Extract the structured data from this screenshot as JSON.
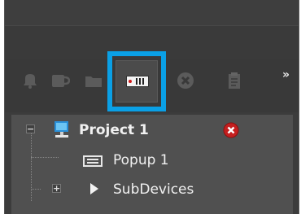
{
  "toolbar": {
    "overflow_glyph": "»",
    "icons": [
      "bell-icon",
      "cup-icon",
      "folder-icon",
      "popup-device-icon",
      "delete-circle-icon",
      "clipboard-icon"
    ],
    "highlight_color": "#0aa0e6"
  },
  "tree": {
    "project": {
      "label": "Project 1",
      "expanded": true,
      "status": "error"
    },
    "items": [
      {
        "label": "Popup 1",
        "icon": "popup-icon"
      },
      {
        "label": "SubDevices",
        "icon": "play-triangle-icon",
        "expanded": false
      }
    ]
  }
}
